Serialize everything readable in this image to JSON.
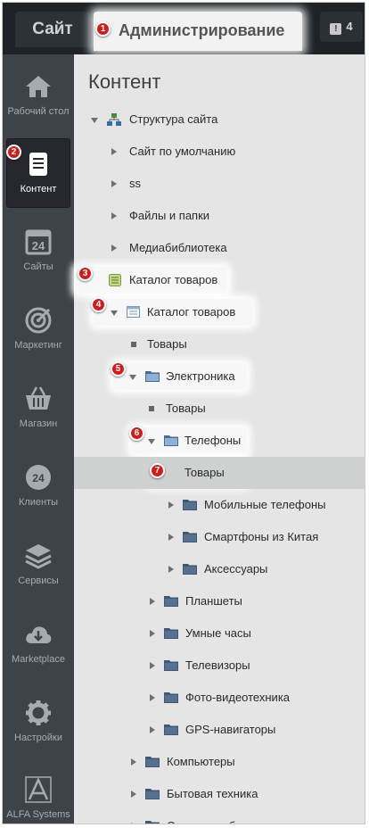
{
  "topbar": {
    "site_tab": "Сайт",
    "admin_tab": "Администрирование",
    "notifications_count": "4"
  },
  "sidebar": {
    "items": [
      {
        "label": "Рабочий стол",
        "icon": "home-icon"
      },
      {
        "label": "Контент",
        "icon": "document-icon"
      },
      {
        "label": "Сайты",
        "icon": "calendar-24-icon"
      },
      {
        "label": "Маркетинг",
        "icon": "target-icon"
      },
      {
        "label": "Магазин",
        "icon": "basket-icon"
      },
      {
        "label": "Клиенты",
        "icon": "clients-24-icon"
      },
      {
        "label": "Сервисы",
        "icon": "layers-icon"
      },
      {
        "label": "Marketplace",
        "icon": "cloud-download-icon"
      },
      {
        "label": "Настройки",
        "icon": "gear-icon"
      },
      {
        "label": "ALFA Systems",
        "icon": "alfa-logo-icon"
      }
    ]
  },
  "main": {
    "title": "Контент",
    "tree": [
      {
        "label": "Структура сайта",
        "icon": "site-structure-icon"
      },
      {
        "label": "Сайт по умолчанию"
      },
      {
        "label": "ss"
      },
      {
        "label": "Файлы и папки"
      },
      {
        "label": "Медиабиблиотека"
      },
      {
        "label": "Каталог товаров",
        "icon": "catalog-icon"
      },
      {
        "label": "Каталог товаров",
        "icon": "iblock-icon"
      },
      {
        "label": "Товары"
      },
      {
        "label": "Электроника",
        "icon": "folder-icon"
      },
      {
        "label": "Товары"
      },
      {
        "label": "Телефоны",
        "icon": "folder-icon"
      },
      {
        "label": "Товары"
      },
      {
        "label": "Мобильные телефоны",
        "icon": "folder-icon"
      },
      {
        "label": "Смартфоны из Китая",
        "icon": "folder-icon"
      },
      {
        "label": "Аксессуары",
        "icon": "folder-icon"
      },
      {
        "label": "Планшеты",
        "icon": "folder-icon"
      },
      {
        "label": "Умные часы",
        "icon": "folder-icon"
      },
      {
        "label": "Телевизоры",
        "icon": "folder-icon"
      },
      {
        "label": "Фото-видеотехника",
        "icon": "folder-icon"
      },
      {
        "label": "GPS-навигаторы",
        "icon": "folder-icon"
      },
      {
        "label": "Компьютеры",
        "icon": "folder-icon"
      },
      {
        "label": "Бытовая техника",
        "icon": "folder-icon"
      },
      {
        "label": "Одежда и обувь",
        "icon": "folder-icon"
      }
    ]
  },
  "badges": [
    "1",
    "2",
    "3",
    "4",
    "5",
    "6",
    "7"
  ],
  "colors": {
    "badge": "#d11c1c",
    "sidebar": "#3d4348",
    "panel": "#e5e5e5",
    "folder": "#4b6a8c"
  }
}
